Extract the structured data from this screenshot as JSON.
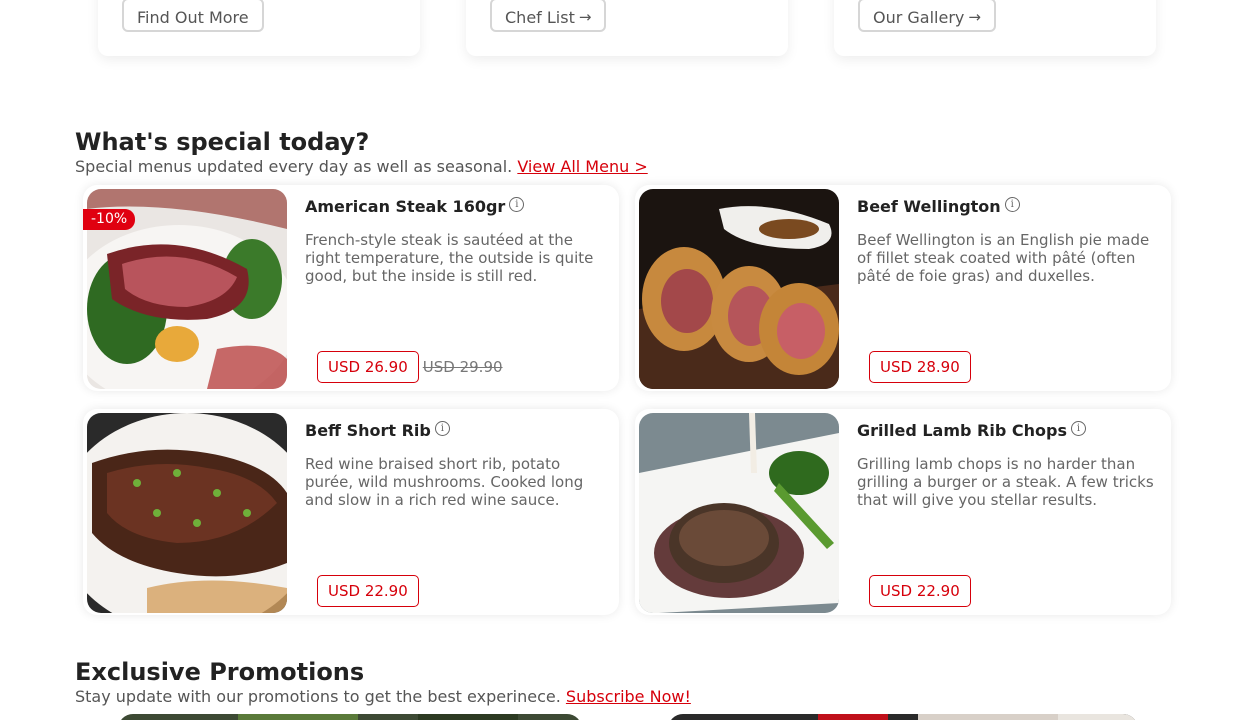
{
  "top_cards": [
    {
      "button_label": "Find Out More",
      "arrow": ""
    },
    {
      "button_label": "Chef List",
      "arrow": "→"
    },
    {
      "button_label": "Our Gallery",
      "arrow": "→"
    }
  ],
  "specials": {
    "title": "What's special today?",
    "subtitle": "Special menus updated every day as well as seasonal.",
    "link_label": "View All Menu >"
  },
  "menu_items": [
    {
      "name": "American Steak 160gr",
      "description": "French-style steak is sautéed at the right temperature, the outside is quite good, but the inside is still red.",
      "price": "USD 26.90",
      "old_price": "USD 29.90",
      "discount": "-10%",
      "image": "steak-plate"
    },
    {
      "name": "Beef Wellington",
      "description": "Beef Wellington is an English pie made of fillet steak coated with pâté (often pâté de foie gras) and duxelles.",
      "price": "USD 28.90",
      "image": "beef-wellington"
    },
    {
      "name": "Beff Short Rib",
      "description": "Red wine braised short rib, potato purée, wild mushrooms. Cooked long and slow in a rich red wine sauce.",
      "price": "USD 22.90",
      "image": "short-rib"
    },
    {
      "name": "Grilled Lamb Rib Chops",
      "description": "Grilling lamb chops is no harder than grilling a burger or a steak. A few tricks that will give you stellar results.",
      "price": "USD 22.90",
      "image": "lamb-chops"
    }
  ],
  "promotions": {
    "title": "Exclusive Promotions",
    "subtitle": "Stay update with our promotions to get the best experinece.",
    "link_label": "Subscribe Now!"
  },
  "colors": {
    "accent": "#d6000b",
    "text": "#222222",
    "muted": "#666666"
  }
}
